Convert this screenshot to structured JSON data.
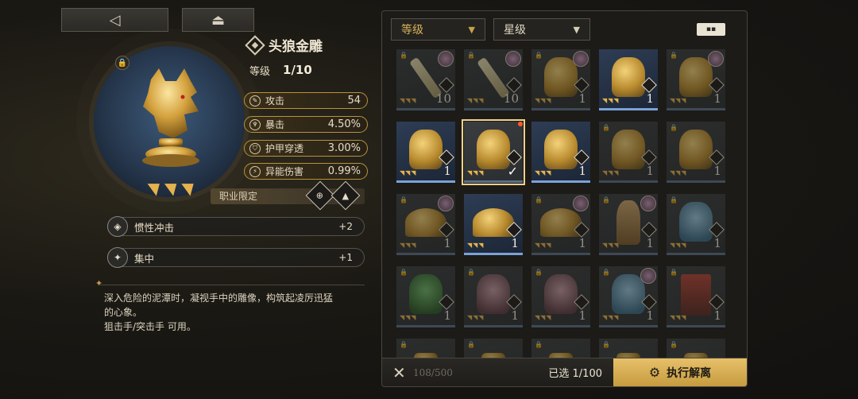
{
  "nav": {
    "back_icon": "◁",
    "home_icon": "⏏"
  },
  "item": {
    "title": "头狼金雕",
    "level_label": "等级",
    "level_value": "1/10",
    "stars": "◥◥◥",
    "lock_icon": "🔒",
    "stats": [
      {
        "icon": "✎",
        "name": "攻击",
        "value": "54"
      },
      {
        "icon": "♆",
        "name": "暴击",
        "value": "4.50%"
      },
      {
        "icon": "⛉",
        "name": "护甲穿透",
        "value": "3.00%"
      },
      {
        "icon": "⚡",
        "name": "异能伤害",
        "value": "0.99%"
      }
    ],
    "restriction_label": "职业限定",
    "class_icons": [
      "⊕",
      "▲"
    ],
    "skills": [
      {
        "icon": "◈",
        "name": "惯性冲击",
        "value": "+2"
      },
      {
        "icon": "✦",
        "name": "集中",
        "value": "+1"
      }
    ],
    "description_lines": [
      "深入危险的泥潭时，凝视手中的雕像，构筑起凌厉迅猛",
      "的心象。",
      "狙击手/突击手 可用。"
    ]
  },
  "inventory": {
    "filters": {
      "level": "等级",
      "star": "星级",
      "dropdown_icon": "▼"
    },
    "view_toggle_icon": "▪▪",
    "cells": [
      {
        "art": "key",
        "lvl": "10",
        "stars": "◥◥◥",
        "state": "dim",
        "avatar": true
      },
      {
        "art": "key",
        "lvl": "10",
        "stars": "◥◥◥",
        "state": "dim",
        "avatar": true
      },
      {
        "art": "bust",
        "lvl": "1",
        "stars": "◥◥◥",
        "state": "dim",
        "avatar": true
      },
      {
        "art": "bust",
        "lvl": "1",
        "stars": "◥◥◥",
        "state": "active",
        "avatar": false
      },
      {
        "art": "bust",
        "lvl": "1",
        "stars": "◥◥◥",
        "state": "dim",
        "avatar": true
      },
      {
        "art": "bust",
        "lvl": "1",
        "stars": "◥◥◥",
        "state": "active",
        "avatar": false
      },
      {
        "art": "bust",
        "lvl": "",
        "stars": "◥◥◥",
        "state": "selected",
        "avatar": false
      },
      {
        "art": "bust",
        "lvl": "1",
        "stars": "◥◥◥",
        "state": "active",
        "avatar": false
      },
      {
        "art": "bust",
        "lvl": "1",
        "stars": "◥◥◥",
        "state": "dim",
        "avatar": false
      },
      {
        "art": "bust",
        "lvl": "1",
        "stars": "◥◥◥",
        "state": "dim",
        "avatar": false
      },
      {
        "art": "wings",
        "lvl": "1",
        "stars": "◥◥◥",
        "state": "dim",
        "avatar": true
      },
      {
        "art": "wings",
        "lvl": "1",
        "stars": "◥◥◥",
        "state": "active",
        "avatar": false
      },
      {
        "art": "wings",
        "lvl": "1",
        "stars": "◥◥◥",
        "state": "dim",
        "avatar": true
      },
      {
        "art": "figure",
        "lvl": "1",
        "stars": "◥◥◥",
        "state": "dim",
        "avatar": true
      },
      {
        "art": "blue",
        "lvl": "1",
        "stars": "◥◥◥",
        "state": "dim",
        "avatar": false
      },
      {
        "art": "green",
        "lvl": "1",
        "stars": "◥◥◥",
        "state": "dim",
        "avatar": false
      },
      {
        "art": "pink",
        "lvl": "1",
        "stars": "◥◥◥",
        "state": "dim",
        "avatar": false
      },
      {
        "art": "pink",
        "lvl": "1",
        "stars": "◥◥◥",
        "state": "dim",
        "avatar": false
      },
      {
        "art": "blue",
        "lvl": "1",
        "stars": "◥◥◥",
        "state": "dim",
        "avatar": true
      },
      {
        "art": "card",
        "lvl": "1",
        "stars": "◥◥◥",
        "state": "dim",
        "avatar": false
      },
      {
        "art": "small",
        "lvl": "",
        "stars": "",
        "state": "dim",
        "avatar": false
      },
      {
        "art": "small",
        "lvl": "",
        "stars": "",
        "state": "dim",
        "avatar": false
      },
      {
        "art": "small",
        "lvl": "",
        "stars": "",
        "state": "dim",
        "avatar": false
      },
      {
        "art": "small",
        "lvl": "",
        "stars": "",
        "state": "dim",
        "avatar": false
      },
      {
        "art": "small",
        "lvl": "",
        "stars": "",
        "state": "dim",
        "avatar": false
      }
    ],
    "cancel_icon": "✕",
    "capacity": "108/500",
    "selected_count": "已选 1/100",
    "execute_label": "执行解离",
    "execute_icon": "⚙"
  }
}
